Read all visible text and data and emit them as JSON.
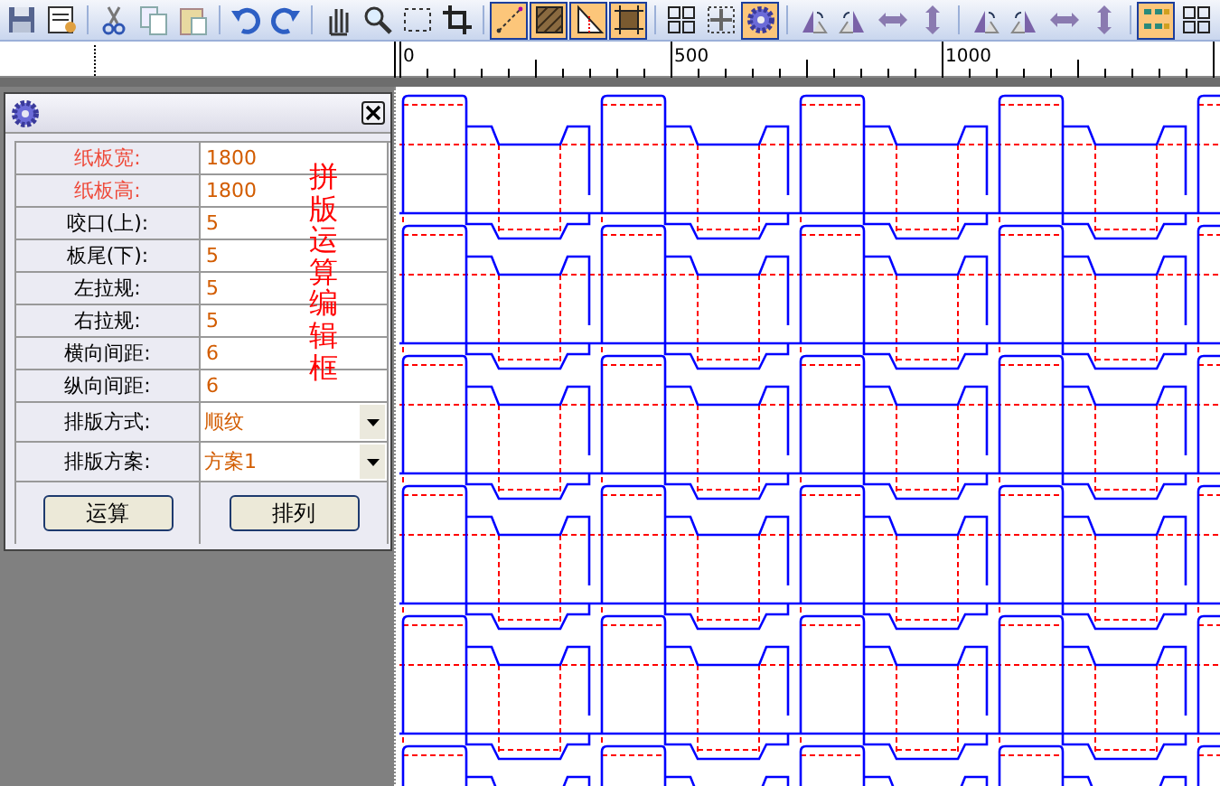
{
  "toolbar": [
    [
      {
        "kind": "save",
        "on": false
      },
      {
        "kind": "preview",
        "on": false
      }
    ],
    [
      {
        "kind": "cut",
        "on": false
      },
      {
        "kind": "copy",
        "on": false
      },
      {
        "kind": "paste",
        "on": false
      }
    ],
    [
      {
        "kind": "undo",
        "on": false
      },
      {
        "kind": "redo",
        "on": false
      }
    ],
    [
      {
        "kind": "hand",
        "on": false
      },
      {
        "kind": "zoom",
        "on": false
      },
      {
        "kind": "marquee",
        "on": false
      },
      {
        "kind": "crop",
        "on": false
      }
    ],
    [
      {
        "kind": "line",
        "on": true
      },
      {
        "kind": "hatch",
        "on": true
      },
      {
        "kind": "triangle",
        "on": true
      },
      {
        "kind": "frame",
        "on": true
      }
    ],
    [
      {
        "kind": "grid",
        "on": false
      },
      {
        "kind": "fit",
        "on": false
      },
      {
        "kind": "gear",
        "on": true
      }
    ],
    [
      {
        "kind": "rotl",
        "on": false
      },
      {
        "kind": "rotr",
        "on": false
      },
      {
        "kind": "hflip",
        "on": false
      },
      {
        "kind": "vflip",
        "on": false
      }
    ],
    [
      {
        "kind": "rotl",
        "on": false
      },
      {
        "kind": "rotr",
        "on": false
      },
      {
        "kind": "hflip",
        "on": false
      },
      {
        "kind": "vflip",
        "on": false
      }
    ],
    [
      {
        "kind": "layout",
        "on": true
      },
      {
        "kind": "grid",
        "on": false
      }
    ]
  ],
  "ruler": {
    "labels": [
      "0",
      "500",
      "1000"
    ]
  },
  "panel": {
    "annotation": "拼版运算编辑框",
    "rows": [
      {
        "kind": "text",
        "label": "纸板宽:",
        "value": "1800",
        "emphasis": true
      },
      {
        "kind": "text",
        "label": "纸板高:",
        "value": "1800",
        "emphasis": true
      },
      {
        "kind": "text",
        "label": "咬口(上):",
        "value": "5",
        "emphasis": false
      },
      {
        "kind": "text",
        "label": "板尾(下):",
        "value": "5",
        "emphasis": false
      },
      {
        "kind": "text",
        "label": "左拉规:",
        "value": "5",
        "emphasis": false
      },
      {
        "kind": "text",
        "label": "右拉规:",
        "value": "5",
        "emphasis": false
      },
      {
        "kind": "text",
        "label": "横向间距:",
        "value": "6",
        "emphasis": false
      },
      {
        "kind": "text",
        "label": "纵向间距:",
        "value": "6",
        "emphasis": false
      },
      {
        "kind": "dropdown",
        "label": "排版方式:",
        "value": "顺纹",
        "emphasis": false
      },
      {
        "kind": "dropdown",
        "label": "排版方案:",
        "value": "方案1",
        "emphasis": false
      }
    ],
    "buttons": [
      "运算",
      "排列"
    ]
  }
}
